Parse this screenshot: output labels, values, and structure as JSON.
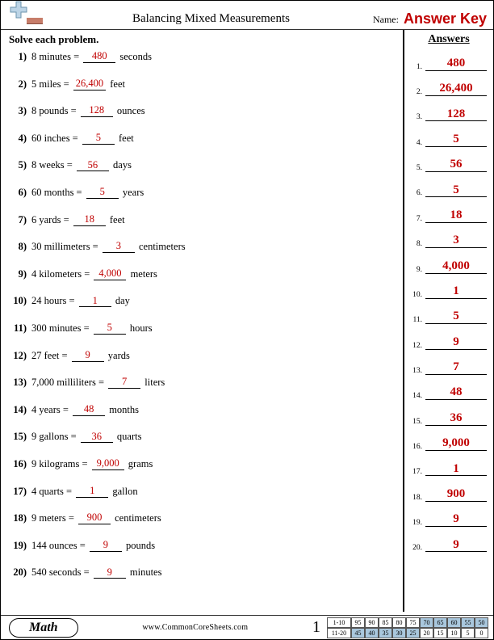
{
  "header": {
    "title": "Balancing Mixed Measurements",
    "name_label": "Name:",
    "answer_key": "Answer Key"
  },
  "instruction": "Solve each problem.",
  "answers_heading": "Answers",
  "problems": [
    {
      "n": "1",
      "lhs": "8 minutes =",
      "ans": "480",
      "rhs": "seconds"
    },
    {
      "n": "2",
      "lhs": "5 miles =",
      "ans": "26,400",
      "rhs": "feet"
    },
    {
      "n": "3",
      "lhs": "8 pounds =",
      "ans": "128",
      "rhs": "ounces"
    },
    {
      "n": "4",
      "lhs": "60 inches =",
      "ans": "5",
      "rhs": "feet"
    },
    {
      "n": "5",
      "lhs": "8 weeks =",
      "ans": "56",
      "rhs": "days"
    },
    {
      "n": "6",
      "lhs": "60 months =",
      "ans": "5",
      "rhs": "years"
    },
    {
      "n": "7",
      "lhs": "6 yards =",
      "ans": "18",
      "rhs": "feet"
    },
    {
      "n": "8",
      "lhs": "30 millimeters =",
      "ans": "3",
      "rhs": "centimeters"
    },
    {
      "n": "9",
      "lhs": "4 kilometers =",
      "ans": "4,000",
      "rhs": "meters"
    },
    {
      "n": "10",
      "lhs": "24 hours =",
      "ans": "1",
      "rhs": "day"
    },
    {
      "n": "11",
      "lhs": "300 minutes =",
      "ans": "5",
      "rhs": "hours"
    },
    {
      "n": "12",
      "lhs": "27 feet =",
      "ans": "9",
      "rhs": "yards"
    },
    {
      "n": "13",
      "lhs": "7,000 milliliters =",
      "ans": "7",
      "rhs": "liters"
    },
    {
      "n": "14",
      "lhs": "4 years =",
      "ans": "48",
      "rhs": "months"
    },
    {
      "n": "15",
      "lhs": "9 gallons =",
      "ans": "36",
      "rhs": "quarts"
    },
    {
      "n": "16",
      "lhs": "9 kilograms =",
      "ans": "9,000",
      "rhs": "grams"
    },
    {
      "n": "17",
      "lhs": "4 quarts =",
      "ans": "1",
      "rhs": "gallon"
    },
    {
      "n": "18",
      "lhs": "9 meters =",
      "ans": "900",
      "rhs": "centimeters"
    },
    {
      "n": "19",
      "lhs": "144 ounces =",
      "ans": "9",
      "rhs": "pounds"
    },
    {
      "n": "20",
      "lhs": "540 seconds =",
      "ans": "9",
      "rhs": "minutes"
    }
  ],
  "footer": {
    "subject": "Math",
    "site": "www.CommonCoreSheets.com",
    "page_number": "1",
    "score_grid": {
      "row1_label": "1-10",
      "row1": [
        "95",
        "90",
        "85",
        "80",
        "75",
        "70",
        "65",
        "60",
        "55",
        "50"
      ],
      "row2_label": "11-20",
      "row2": [
        "45",
        "40",
        "35",
        "30",
        "25",
        "20",
        "15",
        "10",
        "5",
        "0"
      ]
    }
  }
}
